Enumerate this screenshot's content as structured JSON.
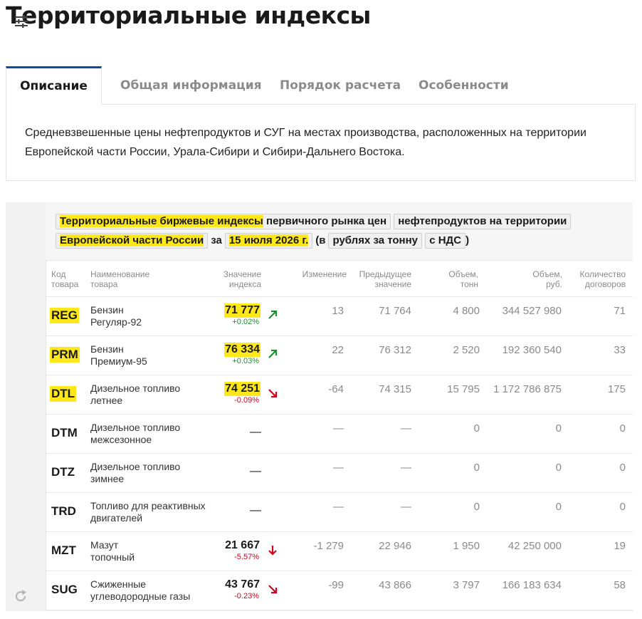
{
  "page": {
    "title": "Территориальные индексы"
  },
  "tabs": [
    {
      "label": "Описание"
    },
    {
      "label": "Общая информация"
    },
    {
      "label": "Порядок расчета"
    },
    {
      "label": "Особенности"
    }
  ],
  "description": "Средневзвешенные цены нефтепродуктов и СУГ на местах производства, расположенных на территории Европейской части России, Урала-Сибири и Сибири-Дальнего Востока.",
  "widget": {
    "title_part1": "Территориальные биржевые индексы",
    "title_part2": " первичного рынка цен",
    "title_part3": "нефтепродуктов на территории",
    "region": "Европейской части России",
    "for_word": "за",
    "date": "15 июля 2026 г.",
    "in_word": "(в",
    "unit": "рублях за тонну",
    "vat": "с НДС",
    "close_paren": ")"
  },
  "table": {
    "headers": {
      "code": [
        "Код",
        "товара"
      ],
      "name": [
        "Наименование",
        "товара"
      ],
      "index": [
        "Значение",
        "индекса"
      ],
      "change": [
        "Изменение"
      ],
      "prev": [
        "Предыдущее",
        "значение"
      ],
      "vol_t": [
        "Объем,",
        "тонн"
      ],
      "vol_rub": [
        "Объем,",
        "руб."
      ],
      "deals": [
        "Количество",
        "договоров"
      ]
    },
    "rows": [
      {
        "code": "REG",
        "name1": "Бензин",
        "name2": "Регуляр-92",
        "index": "71 777",
        "pct": "+0.02%",
        "trend": "up",
        "change": "13",
        "prev": "71 764",
        "vol_t": "4 800",
        "vol_rub": "344 527 980",
        "deals": "71"
      },
      {
        "code": "PRM",
        "name1": "Бензин",
        "name2": "Премиум-95",
        "index": "76 334",
        "pct": "+0.03%",
        "trend": "up",
        "change": "22",
        "prev": "76 312",
        "vol_t": "2 520",
        "vol_rub": "192 360 540",
        "deals": "33"
      },
      {
        "code": "DTL",
        "name1": "Дизельное топливо",
        "name2": "летнее",
        "index": "74 251",
        "pct": "-0.09%",
        "trend": "down-right",
        "change": "-64",
        "prev": "74 315",
        "vol_t": "15 795",
        "vol_rub": "1 172 786 875",
        "deals": "175"
      },
      {
        "code": "DTM",
        "name1": "Дизельное топливо",
        "name2": "межсезонное",
        "index": "—",
        "pct": "",
        "trend": "none",
        "change": "—",
        "prev": "—",
        "vol_t": "0",
        "vol_rub": "0",
        "deals": "0"
      },
      {
        "code": "DTZ",
        "name1": "Дизельное топливо",
        "name2": "зимнее",
        "index": "—",
        "pct": "",
        "trend": "none",
        "change": "—",
        "prev": "—",
        "vol_t": "0",
        "vol_rub": "0",
        "deals": "0"
      },
      {
        "code": "TRD",
        "name1": "Топливо для реактивных",
        "name2": "двигателей",
        "index": "—",
        "pct": "",
        "trend": "none",
        "change": "—",
        "prev": "—",
        "vol_t": "0",
        "vol_rub": "0",
        "deals": "0"
      },
      {
        "code": "MZT",
        "name1": "Мазут",
        "name2": "топочный",
        "index": "21 667",
        "pct": "-5.57%",
        "trend": "down",
        "change": "-1 279",
        "prev": "22 946",
        "vol_t": "1 950",
        "vol_rub": "42 250 000",
        "deals": "19"
      },
      {
        "code": "SUG",
        "name1": "Сжиженные",
        "name2": "углеводородные газы",
        "index": "43 767",
        "pct": "-0.23%",
        "trend": "down-right",
        "change": "-99",
        "prev": "43 866",
        "vol_t": "3 797",
        "vol_rub": "166 183 634",
        "deals": "58"
      }
    ]
  },
  "icons": {
    "settings": "sliders-icon",
    "reload": "refresh-icon"
  },
  "colors": {
    "accent": "#0d4da0",
    "highlight": "#ffe81a",
    "up": "#1a8f2e",
    "down": "#d0021b"
  }
}
